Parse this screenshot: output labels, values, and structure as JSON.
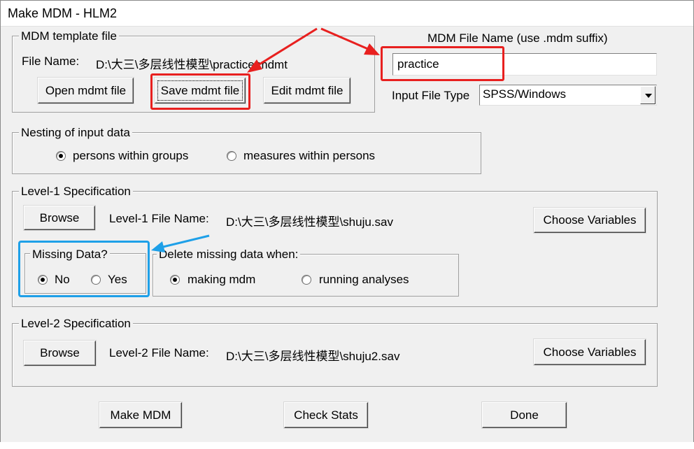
{
  "window": {
    "title": "Make MDM - HLM2"
  },
  "template_group": {
    "legend": "MDM template file",
    "file_name_label": "File Name:",
    "file_name_value": "D:\\大三\\多层线性模型\\practice.mdmt",
    "open_label": "Open mdmt file",
    "save_label": "Save mdmt file",
    "edit_label": "Edit mdmt file"
  },
  "mdm_file": {
    "label": "MDM File Name (use .mdm suffix)",
    "value": "practice",
    "input_type_label": "Input File Type",
    "input_type_value": "SPSS/Windows"
  },
  "nesting": {
    "legend": "Nesting of input data",
    "option1": "persons within groups",
    "option2": "measures within persons",
    "selected": "persons within groups"
  },
  "level1": {
    "legend": "Level-1 Specification",
    "browse_label": "Browse",
    "file_name_label": "Level-1 File Name:",
    "file_name_value": "D:\\大三\\多层线性模型\\shuju.sav",
    "choose_label": "Choose Variables",
    "missing": {
      "legend": "Missing Data?",
      "no_label": "No",
      "yes_label": "Yes",
      "selected": "No"
    },
    "delete": {
      "legend": "Delete missing data when:",
      "option1": "making mdm",
      "option2": "running analyses",
      "selected": "making mdm"
    }
  },
  "level2": {
    "legend": "Level-2 Specification",
    "browse_label": "Browse",
    "file_name_label": "Level-2 File Name:",
    "file_name_value": "D:\\大三\\多层线性模型\\shuju2.sav",
    "choose_label": "Choose Variables"
  },
  "footer": {
    "make_label": "Make MDM",
    "check_label": "Check Stats",
    "done_label": "Done"
  },
  "annotations": {
    "red": "#e8201f",
    "blue": "#1ea0e8"
  }
}
